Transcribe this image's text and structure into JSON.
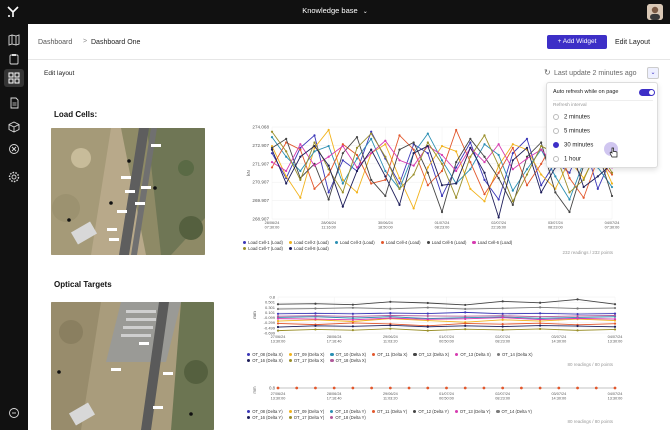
{
  "topbar": {
    "title": "Knowledge base",
    "chevron": "chevron-down-icon"
  },
  "breadcrumb": {
    "root": "Dashboard",
    "separator": ">",
    "current": "Dashboard One"
  },
  "actions": {
    "add_widget": "+ Add Widget",
    "edit_layout": "Edit Layout"
  },
  "subheader": {
    "edit_layout": "Edit layout",
    "last_update": "Last update 2 minutes ago"
  },
  "refresh_panel": {
    "auto_refresh_label": "Auto refresh while on page",
    "auto_refresh_on": true,
    "interval_label": "Refresh interval",
    "options": [
      "2 minutes",
      "5 minutes",
      "30 minutes",
      "1 hour"
    ],
    "selected": "30 minutes"
  },
  "sections": {
    "load_cells": {
      "title": "Load Cells:",
      "readings": "232 readings / 232 points"
    },
    "optical": {
      "title": "Optical Targets",
      "readings_x": "80 readings / 80 points",
      "readings_y": "80 readings / 80 points"
    }
  },
  "colors": {
    "accent": "#3d2fc7",
    "sidebar": "#111111"
  },
  "chart_data": [
    {
      "type": "line",
      "title": "",
      "ylabel": "kN",
      "y_ticks": [
        "274.068",
        "272.907",
        "271.907",
        "270.907",
        "269.907",
        "268.907"
      ],
      "ylim": [
        268.907,
        274.068
      ],
      "x_ticks": [
        "28/06/24\n07:30:00",
        "28/06/24\n11:16:00",
        "30/06/24\n18:50:00",
        "01/07/24\n08:23:00",
        "02/07/24\n22:36:00",
        "03/07/24\n08:23:00",
        "04/07/24\n07:30:00"
      ],
      "grid": true,
      "series": [
        {
          "name": "Load Cell-1 (Load)",
          "color": "#3b37b8",
          "values": [
            272.6,
            271.2,
            272.9,
            273.6,
            270.4,
            272.2,
            271.6,
            273.8,
            272.3,
            270.9,
            273.1,
            272.6,
            270.2,
            271.8,
            273.2,
            271.1,
            270.0,
            272.6,
            273.4,
            270.8,
            272.1,
            271.5,
            273.3,
            270.6,
            272.4
          ]
        },
        {
          "name": "Load Cell-2 (Load)",
          "color": "#f2b31c",
          "values": [
            273.0,
            271.3,
            270.1,
            272.9,
            273.9,
            271.1,
            270.4,
            272.6,
            273.1,
            271.2,
            269.5,
            271.8,
            273.0,
            272.7,
            270.6,
            269.9,
            271.9,
            273.1,
            272.8,
            271.4,
            270.6,
            272.2,
            271.2,
            272.7,
            270.9
          ]
        },
        {
          "name": "Load Cell-3 (Load)",
          "color": "#2a8fb3",
          "values": [
            273.5,
            272.4,
            271.6,
            272.7,
            273.0,
            270.9,
            272.3,
            273.4,
            271.6,
            270.6,
            272.6,
            273.7,
            272.2,
            270.9,
            271.7,
            273.1,
            272.5,
            270.5,
            271.7,
            272.8,
            271.3,
            270.0,
            272.1,
            271.8,
            270.7
          ]
        },
        {
          "name": "Load Cell-4 (Load)",
          "color": "#e2572c",
          "values": [
            271.8,
            273.2,
            272.8,
            270.6,
            271.4,
            273.1,
            272.5,
            270.9,
            271.1,
            273.6,
            272.8,
            270.8,
            271.6,
            273.9,
            272.1,
            270.3,
            271.5,
            272.9,
            270.8,
            272.0,
            273.4,
            271.2,
            270.1,
            272.3,
            271.4
          ]
        },
        {
          "name": "Load Cell-5 (Load)",
          "color": "#444444",
          "values": [
            272.9,
            273.4,
            271.2,
            272.0,
            270.0,
            272.6,
            273.5,
            271.1,
            270.2,
            272.8,
            273.2,
            271.5,
            269.3,
            272.1,
            273.4,
            272.4,
            271.2,
            269.7,
            272.4,
            273.2,
            270.4,
            269.3,
            271.9,
            272.7,
            270.2
          ]
        },
        {
          "name": "Load Cell-6 (Load)",
          "color": "#d63bb0",
          "values": [
            272.1,
            271.6,
            273.1,
            271.9,
            272.4,
            273.0,
            271.8,
            272.6,
            273.3,
            272.2,
            271.9,
            273.0,
            272.5,
            271.6,
            272.9,
            272.1,
            273.1,
            271.7,
            272.3,
            272.8,
            271.9,
            272.6,
            272.0,
            272.4,
            271.8
          ]
        },
        {
          "name": "Load Cell-7 (Load)",
          "color": "#9a8f2a",
          "values": [
            273.8,
            272.7,
            271.1,
            273.2,
            271.7,
            270.4,
            272.9,
            273.7,
            272.4,
            270.6,
            271.4,
            273.2,
            272.0,
            270.1,
            272.4,
            273.6,
            271.9,
            269.9,
            271.4,
            273.0,
            272.6,
            270.4,
            271.1,
            272.9,
            271.5
          ]
        },
        {
          "name": "Load Cell-8 (Load)",
          "color": "#1e1e5a",
          "values": [
            272.8,
            270.9,
            272.4,
            273.0,
            271.9,
            269.6,
            271.6,
            272.8,
            271.3,
            269.7,
            272.6,
            273.0,
            270.8,
            270.9,
            272.9,
            271.5,
            269.0,
            272.2,
            272.9,
            270.4,
            271.8,
            273.0,
            270.7,
            271.3,
            272.0
          ]
        }
      ]
    },
    {
      "type": "line",
      "title": "",
      "ylabel": "mm",
      "y_ticks": [
        "0.8",
        "0.501",
        "0.301",
        "0.101",
        "-0.099",
        "-0.299",
        "-0.499",
        "-0.699"
      ],
      "ylim": [
        -0.699,
        0.8
      ],
      "x_ticks": [
        "27/06/24\n13:30:00",
        "28/06/24\n17:16:40",
        "29/06/24\n11:03:20",
        "01/07/24\n00:50:00",
        "02/07/24\n08:23:00",
        "03/07/24\n14:30:00",
        "04/07/24\n13:30:00"
      ],
      "series": [
        {
          "name": "OT_08 (Delta X)",
          "color": "#3b37b8",
          "values": [
            0.1,
            0.12,
            0.1,
            0.13,
            0.11,
            0.16,
            0.1,
            0.12,
            0.09,
            0.11
          ]
        },
        {
          "name": "OT_09 (Delta X)",
          "color": "#f2b31c",
          "values": [
            -0.2,
            -0.15,
            -0.22,
            -0.1,
            -0.18,
            -0.25,
            -0.15,
            -0.2,
            -0.12,
            -0.18
          ]
        },
        {
          "name": "OT_10 (Delta X)",
          "color": "#2a8fb3",
          "values": [
            -0.05,
            -0.02,
            -0.08,
            -0.02,
            -0.1,
            -0.06,
            -0.03,
            -0.09,
            -0.05,
            -0.02
          ]
        },
        {
          "name": "OT_11 (Delta X)",
          "color": "#e2572c",
          "values": [
            -0.3,
            -0.35,
            -0.28,
            -0.32,
            -0.4,
            -0.3,
            -0.33,
            -0.29,
            -0.36,
            -0.31
          ]
        },
        {
          "name": "OT_12 (Delta X)",
          "color": "#444444",
          "values": [
            0.5,
            0.52,
            0.48,
            0.6,
            0.55,
            0.47,
            0.62,
            0.56,
            0.7,
            0.5
          ]
        },
        {
          "name": "OT_13 (Delta X)",
          "color": "#d63bb0",
          "values": [
            -0.1,
            -0.12,
            -0.15,
            -0.08,
            -0.13,
            -0.11,
            -0.06,
            -0.14,
            -0.09,
            -0.12
          ]
        },
        {
          "name": "OT_14 (Delta X)",
          "color": "#7a7a7a",
          "values": [
            0.3,
            0.32,
            0.35,
            0.31,
            0.36,
            0.3,
            0.33,
            0.37,
            0.32,
            0.34
          ]
        },
        {
          "name": "OT_16 (Delta X)",
          "color": "#1e1e5a",
          "values": [
            -0.45,
            -0.4,
            -0.42,
            -0.38,
            -0.44,
            -0.4,
            -0.43,
            -0.39,
            -0.41,
            -0.44
          ]
        },
        {
          "name": "OT_17 (Delta X)",
          "color": "#9a8f2a",
          "values": [
            -0.6,
            -0.55,
            -0.58,
            -0.52,
            -0.6,
            -0.54,
            -0.57,
            -0.53,
            -0.59,
            -0.55
          ]
        },
        {
          "name": "OT_18 (Delta X)",
          "color": "#b05a9a",
          "values": [
            0.0,
            0.02,
            -0.01,
            0.03,
            0.01,
            0.0,
            0.02,
            -0.02,
            0.01,
            0.03
          ]
        }
      ]
    },
    {
      "type": "line",
      "title": "",
      "ylabel": "mm",
      "y_ticks": [
        "0.8"
      ],
      "x_ticks": [
        "27/06/24\n13:30:00",
        "28/06/24\n17:16:40",
        "29/06/24\n11:03:20",
        "01/07/24\n00:50:00",
        "02/07/24\n08:23:00",
        "03/07/24\n14:30:00",
        "04/07/24\n13:30:00"
      ],
      "series": [
        {
          "name": "OT_08 (Delta Y)",
          "color": "#3b37b8"
        },
        {
          "name": "OT_09 (Delta Y)",
          "color": "#f2b31c"
        },
        {
          "name": "OT_10 (Delta Y)",
          "color": "#2a8fb3"
        },
        {
          "name": "OT_11 (Delta Y)",
          "color": "#e2572c"
        },
        {
          "name": "OT_12 (Delta Y)",
          "color": "#444444"
        },
        {
          "name": "OT_13 (Delta Y)",
          "color": "#d63bb0"
        },
        {
          "name": "OT_14 (Delta Y)",
          "color": "#7a7a7a"
        },
        {
          "name": "OT_16 (Delta Y)",
          "color": "#1e1e5a"
        },
        {
          "name": "OT_17 (Delta Y)",
          "color": "#9a8f2a"
        },
        {
          "name": "OT_18 (Delta Y)",
          "color": "#b05a9a"
        }
      ]
    }
  ]
}
